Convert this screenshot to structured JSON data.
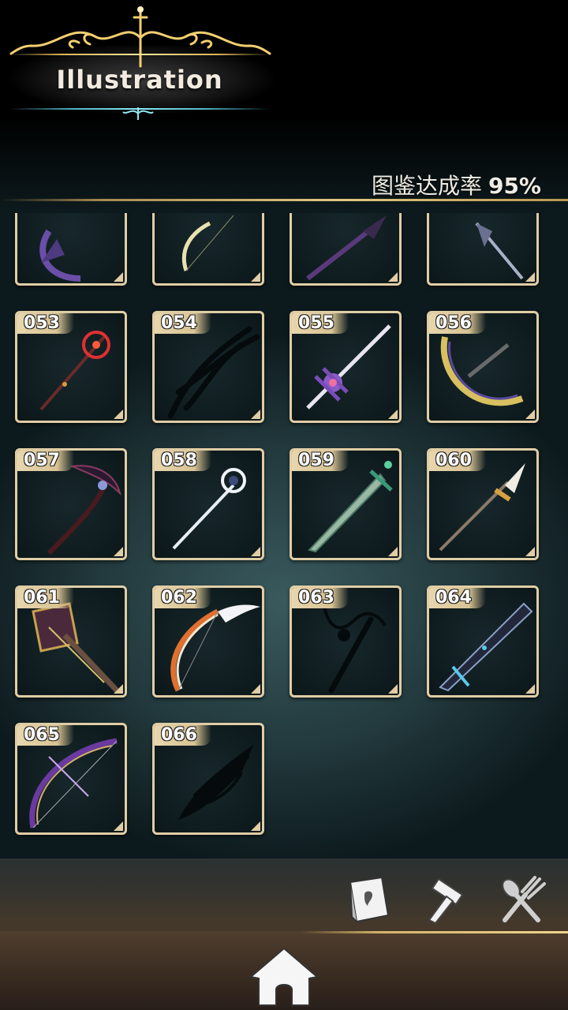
{
  "header": {
    "title": "Illustration"
  },
  "completion": {
    "label": "图鉴达成率",
    "value": "95%"
  },
  "grid": {
    "partial_row": [
      "",
      "",
      "",
      ""
    ],
    "cards": [
      {
        "id": "053",
        "weapon": "red-staff-icon",
        "discovered": true
      },
      {
        "id": "054",
        "weapon": "shadow-silhouette-icon",
        "discovered": false
      },
      {
        "id": "055",
        "weapon": "purple-spear-icon",
        "discovered": true
      },
      {
        "id": "056",
        "weapon": "golden-bow-icon",
        "discovered": true
      },
      {
        "id": "057",
        "weapon": "scythe-icon",
        "discovered": true
      },
      {
        "id": "058",
        "weapon": "white-staff-icon",
        "discovered": true
      },
      {
        "id": "059",
        "weapon": "green-sword-icon",
        "discovered": true
      },
      {
        "id": "060",
        "weapon": "golden-spear-icon",
        "discovered": true
      },
      {
        "id": "061",
        "weapon": "golden-hammer-icon",
        "discovered": true
      },
      {
        "id": "062",
        "weapon": "winged-bow-icon",
        "discovered": true
      },
      {
        "id": "063",
        "weapon": "shadow-silhouette-icon",
        "discovered": false
      },
      {
        "id": "064",
        "weapon": "dark-greatsword-icon",
        "discovered": true
      },
      {
        "id": "065",
        "weapon": "purple-bow-icon",
        "discovered": true
      },
      {
        "id": "066",
        "weapon": "shadow-silhouette-icon",
        "discovered": false
      }
    ]
  },
  "nav": {
    "items": [
      {
        "name": "book-icon"
      },
      {
        "name": "hammer-icon"
      },
      {
        "name": "fork-spoon-icon"
      },
      {
        "name": "home-icon"
      }
    ]
  },
  "colors": {
    "card_border": "#e0cda5",
    "accent_gold": "#e4c77e",
    "accent_cyan": "#8ee8f3"
  }
}
